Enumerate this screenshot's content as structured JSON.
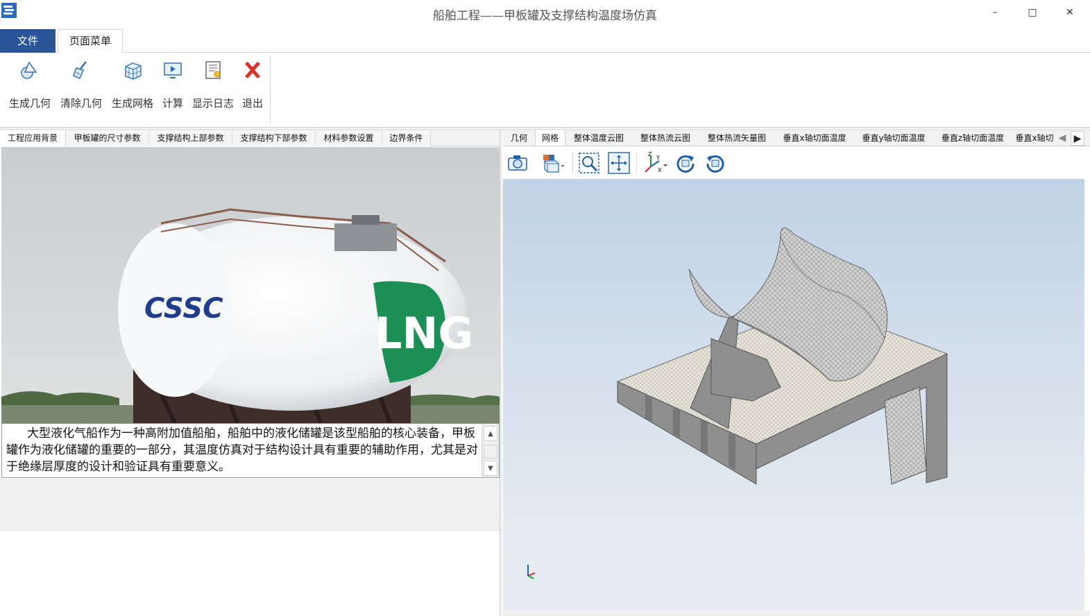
{
  "window": {
    "title": "船舶工程——甲板罐及支撑结构温度场仿真",
    "minimize_glyph": "–",
    "maximize_glyph": "□",
    "close_glyph": "✕"
  },
  "ribbon_tabs": {
    "file": "文件",
    "page_menu": "页面菜单"
  },
  "ribbon": {
    "buttons": [
      {
        "label": "生成几何",
        "icon": "geometry-icon"
      },
      {
        "label": "清除几何",
        "icon": "broom-icon"
      },
      {
        "label": "生成网格",
        "icon": "mesh-cube-icon"
      },
      {
        "label": "计算",
        "icon": "monitor-play-icon"
      },
      {
        "label": "显示日志",
        "icon": "log-document-icon"
      },
      {
        "label": "退出",
        "icon": "red-x-icon"
      }
    ]
  },
  "left_panel": {
    "tabs": [
      "工程应用背景",
      "甲板罐的尺寸参数",
      "支撑结构上部参数",
      "支撑结构下部参数",
      "材料参数设置",
      "边界条件"
    ],
    "photo_text": {
      "logo": "CSSC",
      "band": "LNG"
    },
    "description": "大型液化气船作为一种高附加值船舶，船舶中的液化储罐是该型船舶的核心装备，甲板罐作为液化储罐的重要的一部分，其温度仿真对于结构设计具有重要的辅助作用，尤其是对于绝缘层厚度的设计和验证具有重要意义。"
  },
  "right_panel": {
    "tabs": [
      "几何",
      "网格",
      "整体温度云图",
      "整体热流云图",
      "整体热流矢量图",
      "垂直x轴切面温度",
      "垂直y轴切面温度",
      "垂直z轴切面温度",
      "垂直x轴切"
    ],
    "active_tab": "网格",
    "toolbar_icons": [
      "camera-icon",
      "view-cube-icon",
      "zoom-fit-icon",
      "pan-move-icon",
      "axes-icon",
      "rotate-right-icon",
      "rotate-left-icon"
    ],
    "axis_labels": {
      "x": "X",
      "y": "Y",
      "z": "Z"
    },
    "colors": {
      "viewport_top": "#c0d2e6",
      "viewport_bottom": "#e8edf2",
      "mesh_surface": "#e8e4d8",
      "mesh_dark": "#7a7a7a"
    }
  }
}
